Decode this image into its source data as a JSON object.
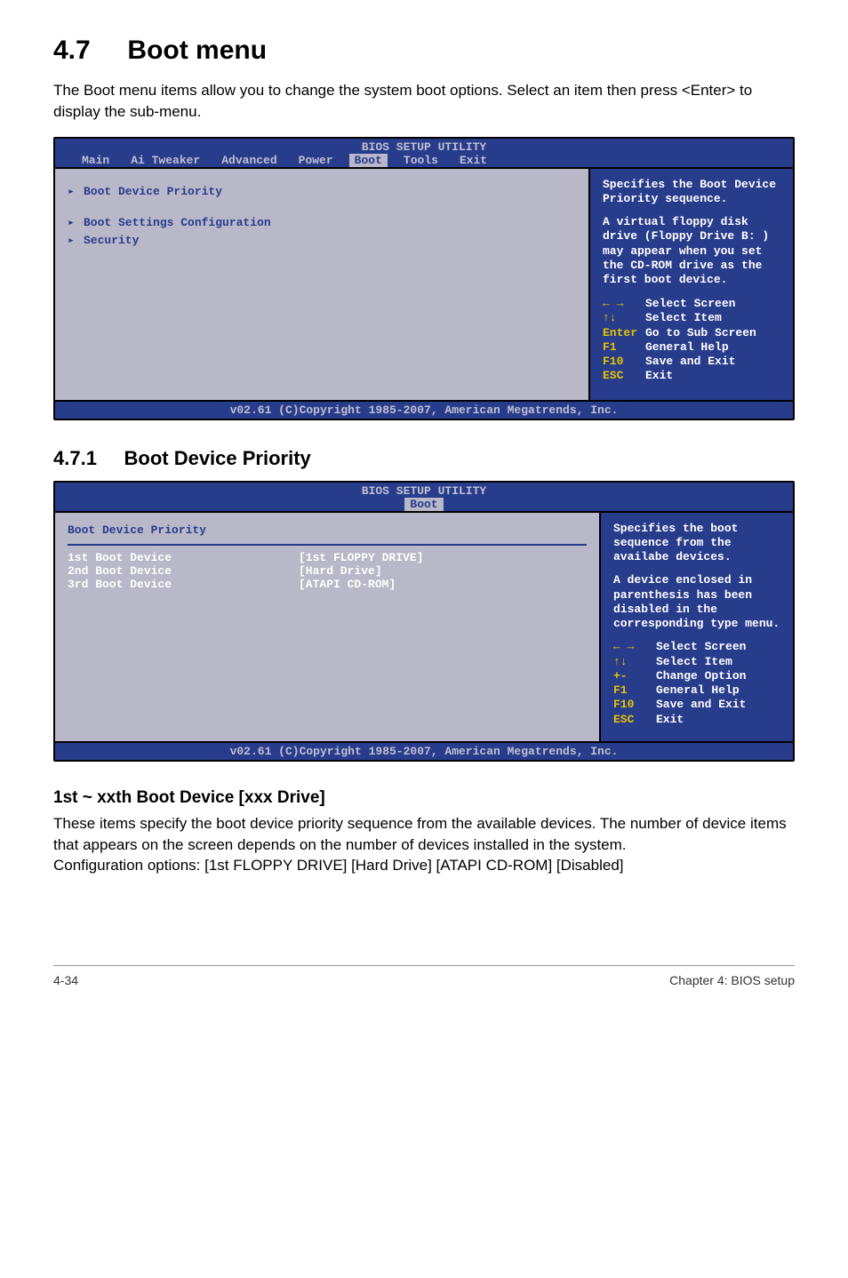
{
  "section": {
    "number": "4.7",
    "title": "Boot menu",
    "intro": "The Boot menu items allow you to change the system boot options. Select an item then press <Enter> to display the sub-menu."
  },
  "bios1": {
    "header": "BIOS SETUP UTILITY",
    "tabs": [
      "Main",
      "Ai Tweaker",
      "Advanced",
      "Power",
      "Boot",
      "Tools",
      "Exit"
    ],
    "active_tab": "Boot",
    "items": [
      "Boot Device Priority",
      "Boot Settings Configuration",
      "Security"
    ],
    "help1": "Specifies the Boot Device Priority sequence.",
    "help2": "A virtual floppy disk drive (Floppy Drive B: ) may appear when you set the CD-ROM drive as the first boot device.",
    "controls": [
      {
        "k": "← →",
        "v": "Select Screen"
      },
      {
        "k": "↑↓",
        "v": "Select Item"
      },
      {
        "k": "Enter",
        "v": "Go to Sub Screen"
      },
      {
        "k": "F1",
        "v": "General Help"
      },
      {
        "k": "F10",
        "v": "Save and Exit"
      },
      {
        "k": "ESC",
        "v": "Exit"
      }
    ],
    "footer": "v02.61 (C)Copyright 1985-2007, American Megatrends, Inc."
  },
  "sub": {
    "number": "4.7.1",
    "title": "Boot Device Priority"
  },
  "bios2": {
    "header": "BIOS SETUP UTILITY",
    "active_tab": "Boot",
    "title_row": "Boot Device Priority",
    "rows": [
      {
        "label": "1st Boot Device",
        "val": "[1st FLOPPY DRIVE]"
      },
      {
        "label": "2nd Boot Device",
        "val": "[Hard Drive]"
      },
      {
        "label": "3rd Boot Device",
        "val": "[ATAPI CD-ROM]"
      }
    ],
    "help1": "Specifies the boot sequence from the availabe devices.",
    "help2": "A device enclosed in parenthesis has been disabled in the corresponding type menu.",
    "controls": [
      {
        "k": "← →",
        "v": "Select Screen"
      },
      {
        "k": "↑↓",
        "v": "Select Item"
      },
      {
        "k": "+-",
        "v": "Change Option"
      },
      {
        "k": "F1",
        "v": "General Help"
      },
      {
        "k": "F10",
        "v": "Save and Exit"
      },
      {
        "k": "ESC",
        "v": "Exit"
      }
    ],
    "footer": "v02.61 (C)Copyright 1985-2007, American Megatrends, Inc."
  },
  "field": {
    "title": "1st ~ xxth Boot Device [xxx Drive]",
    "p1": "These items specify the boot device priority sequence from the available devices. The number of device items that appears on the screen depends on the number of devices installed in the system.",
    "p2": "Configuration options: [1st FLOPPY DRIVE] [Hard Drive] [ATAPI CD-ROM] [Disabled]"
  },
  "footer": {
    "left": "4-34",
    "right": "Chapter 4: BIOS setup"
  }
}
